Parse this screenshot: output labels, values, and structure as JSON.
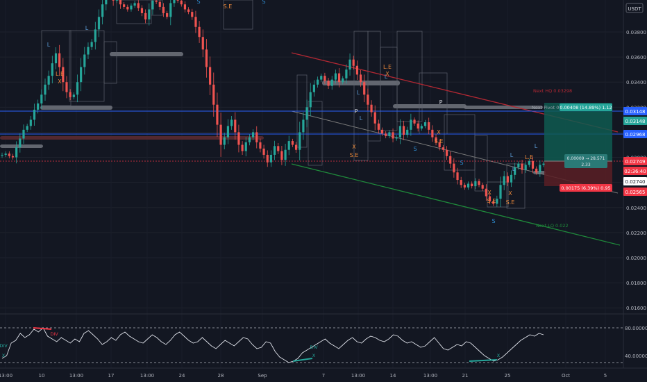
{
  "chart_data": [
    {
      "type": "candlestick",
      "title": "",
      "currency": "USDT",
      "ylim": [
        0.0155,
        0.0405
      ],
      "y_ticks": [
        0.016,
        0.018,
        0.02,
        0.022,
        0.024,
        0.026,
        0.028,
        0.03,
        0.032,
        0.034,
        0.036,
        0.038,
        0.04
      ],
      "y_tick_labels": [
        "0.01600",
        "0.01800",
        "0.02000",
        "0.02200",
        "0.02400",
        "0.02600",
        "0.02800",
        "0.03000",
        "0.03200",
        "0.03400",
        "0.03600",
        "0.03800"
      ],
      "x_tick_labels": [
        "13:00",
        "10",
        "13:00",
        "17",
        "13:00",
        "24",
        "28",
        "Sep",
        "7",
        "13:00",
        "14",
        "13:00",
        "21",
        "25",
        "Oct",
        "5"
      ],
      "price_close_series_approx": [
        0.0282,
        0.0283,
        0.0281,
        0.028,
        0.0288,
        0.0295,
        0.0302,
        0.0305,
        0.031,
        0.0318,
        0.0323,
        0.033,
        0.0338,
        0.0345,
        0.0355,
        0.0363,
        0.0352,
        0.034,
        0.0332,
        0.0328,
        0.033,
        0.034,
        0.0352,
        0.0362,
        0.0368,
        0.0372,
        0.0382,
        0.0392,
        0.0402,
        0.041,
        0.0412,
        0.0405,
        0.0408,
        0.0402,
        0.04,
        0.0398,
        0.0401,
        0.0403,
        0.0399,
        0.0395,
        0.039,
        0.0398,
        0.0405,
        0.0404,
        0.04,
        0.0395,
        0.0392,
        0.0403,
        0.0408,
        0.0405,
        0.0402,
        0.0398,
        0.0396,
        0.0392,
        0.0384,
        0.0376,
        0.0366,
        0.0352,
        0.0338,
        0.0322,
        0.0306,
        0.029,
        0.0296,
        0.0305,
        0.031,
        0.03,
        0.029,
        0.0285,
        0.0292,
        0.0296,
        0.03,
        0.0292,
        0.0287,
        0.0282,
        0.0276,
        0.0282,
        0.0289,
        0.0285,
        0.0278,
        0.0286,
        0.0293,
        0.029,
        0.0286,
        0.03,
        0.031,
        0.032,
        0.0332,
        0.0338,
        0.0342,
        0.0345,
        0.0341,
        0.0337,
        0.0342,
        0.0347,
        0.034,
        0.0343,
        0.035,
        0.0358,
        0.0353,
        0.0346,
        0.034,
        0.033,
        0.0322,
        0.0316,
        0.0307,
        0.0302,
        0.0299,
        0.0297,
        0.03,
        0.0295,
        0.0296,
        0.0305,
        0.0298,
        0.0302,
        0.031,
        0.0307,
        0.0303,
        0.0305,
        0.0308,
        0.0302,
        0.0296,
        0.0292,
        0.0288,
        0.0286,
        0.0281,
        0.0275,
        0.0268,
        0.0262,
        0.0258,
        0.0256,
        0.0259,
        0.0257,
        0.0261,
        0.0258,
        0.0255,
        0.0249,
        0.0245,
        0.0243,
        0.0247,
        0.0258,
        0.0265,
        0.026,
        0.0266,
        0.0272,
        0.0275,
        0.027,
        0.0274,
        0.0277,
        0.0271,
        0.0268,
        0.0274,
        0.0275
      ],
      "price_labels": [
        {
          "label": "0.03148",
          "color": "#2962ff"
        },
        {
          "label": "0.03148",
          "color": "#26a69a"
        },
        {
          "label": "0.02968",
          "color": "#2962ff"
        },
        {
          "label": "0.02749",
          "color": "#f23645"
        },
        {
          "label": "02:36:40",
          "color": "#f23645"
        },
        {
          "label": "0.02740",
          "color": "#ffffff"
        },
        {
          "label": "0.02565",
          "color": "#f23645"
        }
      ],
      "annotations": {
        "next_hq": "Next HQ 0.03298",
        "next_pivot": "Next Pivot 0.03",
        "next_lq": "Next LQ 0.022",
        "target_box": "0.00408 (14.89%) 1.12",
        "risk_box": "0.00175 (6.39%) 0.95",
        "entry_box_l1": "0.00009 → 28.571",
        "entry_box_l2": "2.33"
      },
      "pattern_labels": [
        "L",
        "L",
        "L",
        "L",
        "L",
        "L",
        "L",
        "L",
        "L.E",
        "L.E",
        "L.E",
        "S.E",
        "S.E",
        "S.E",
        "S.E",
        "S.E",
        "S",
        "S",
        "S",
        "S",
        "S",
        "P",
        "P",
        "X",
        "X",
        "X",
        "X",
        "X",
        "X"
      ]
    },
    {
      "type": "line",
      "title": "",
      "ylim": [
        20,
        100
      ],
      "y_tick_labels": [
        "80.00000",
        "40.00000"
      ],
      "levels": [
        80,
        30
      ],
      "labels": [
        "DIV",
        "DIV",
        "DIV",
        "X",
        "X",
        "X"
      ],
      "values_approx": [
        36,
        40,
        58,
        62,
        72,
        66,
        70,
        78,
        74,
        80,
        68,
        64,
        60,
        66,
        62,
        58,
        64,
        60,
        72,
        76,
        70,
        64,
        56,
        60,
        66,
        62,
        70,
        74,
        68,
        64,
        60,
        58,
        64,
        70,
        66,
        60,
        56,
        62,
        70,
        74,
        68,
        62,
        58,
        60,
        66,
        60,
        54,
        50,
        56,
        62,
        58,
        54,
        60,
        66,
        64,
        56,
        50,
        52,
        60,
        58,
        46,
        38,
        34,
        30,
        32,
        36,
        44,
        48,
        52,
        56,
        60,
        64,
        58,
        54,
        50,
        56,
        62,
        66,
        60,
        58,
        64,
        68,
        66,
        62,
        60,
        64,
        70,
        68,
        62,
        58,
        60,
        56,
        52,
        54,
        60,
        66,
        58,
        50,
        48,
        52,
        56,
        54,
        60,
        58,
        52,
        46,
        40,
        36,
        32,
        34,
        38,
        44,
        50,
        56,
        62,
        66,
        70,
        68,
        72,
        70
      ]
    }
  ]
}
